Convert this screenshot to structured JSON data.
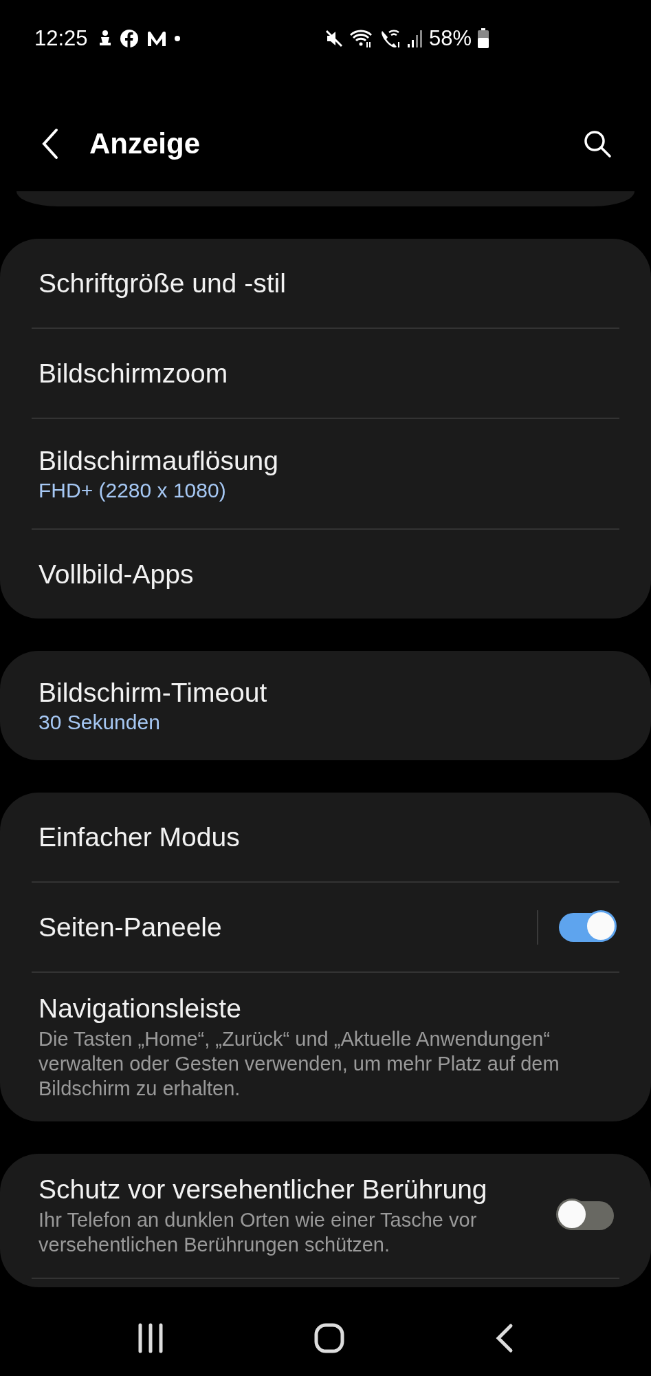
{
  "status_bar": {
    "time": "12:25",
    "battery": "58%"
  },
  "header": {
    "title": "Anzeige"
  },
  "groups": [
    {
      "clipped": false,
      "items": [
        {
          "kind": "link",
          "title": "Schriftgröße und -stil"
        },
        {
          "kind": "link",
          "title": "Bildschirmzoom"
        },
        {
          "kind": "link",
          "title": "Bildschirmauflösung",
          "value": "FHD+ (2280 x 1080)"
        },
        {
          "kind": "link",
          "title": "Vollbild-Apps"
        }
      ]
    },
    {
      "clipped": false,
      "items": [
        {
          "kind": "link",
          "title": "Bildschirm-Timeout",
          "value": "30 Sekunden"
        }
      ]
    },
    {
      "clipped": false,
      "items": [
        {
          "kind": "link",
          "title": "Einfacher Modus"
        },
        {
          "kind": "split_switch",
          "title": "Seiten-Paneele",
          "on": true
        },
        {
          "kind": "link",
          "title": "Navigationsleiste",
          "description": "Die Tasten „Home“, „Zurück“ und „Aktuelle Anwendungen“ verwalten oder Gesten verwenden, um mehr Platz auf dem Bildschirm zu erhalten."
        }
      ]
    },
    {
      "clipped": true,
      "items": [
        {
          "kind": "switch",
          "title": "Schutz vor versehentlicher Berührung",
          "description": "Ihr Telefon an dunklen Orten wie einer Tasche vor versehentlichen Berührungen schützen.",
          "on": false
        }
      ]
    }
  ]
}
